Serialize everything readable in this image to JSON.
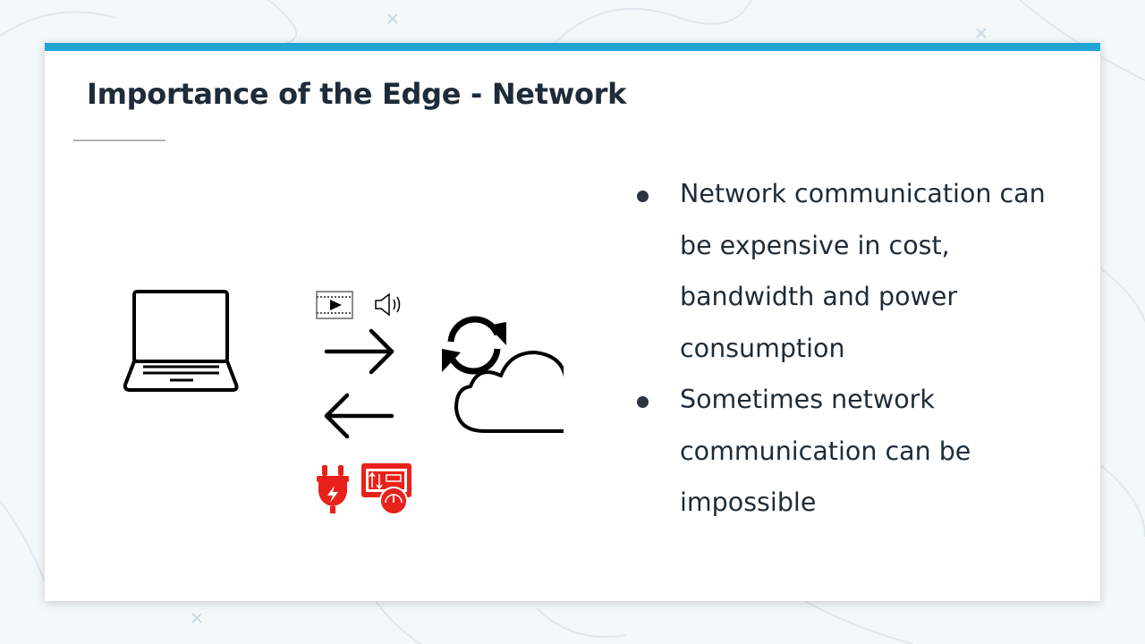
{
  "slide": {
    "title": "Importance of the Edge - Network",
    "accent_color": "#1fa4d3",
    "icon_colors": {
      "line": "#000000",
      "cost": "#e8221b"
    },
    "illustration_icons": [
      "laptop-icon",
      "video-icon",
      "speaker-icon",
      "arrow-right-icon",
      "arrow-left-icon",
      "sync-icon",
      "cloud-icon",
      "power-plug-icon",
      "bandwidth-meter-icon"
    ],
    "bullets": [
      {
        "text": "Network communication can be expensive in cost, bandwidth and power consumption"
      },
      {
        "text": "Sometimes network communication can be impossible"
      }
    ]
  }
}
